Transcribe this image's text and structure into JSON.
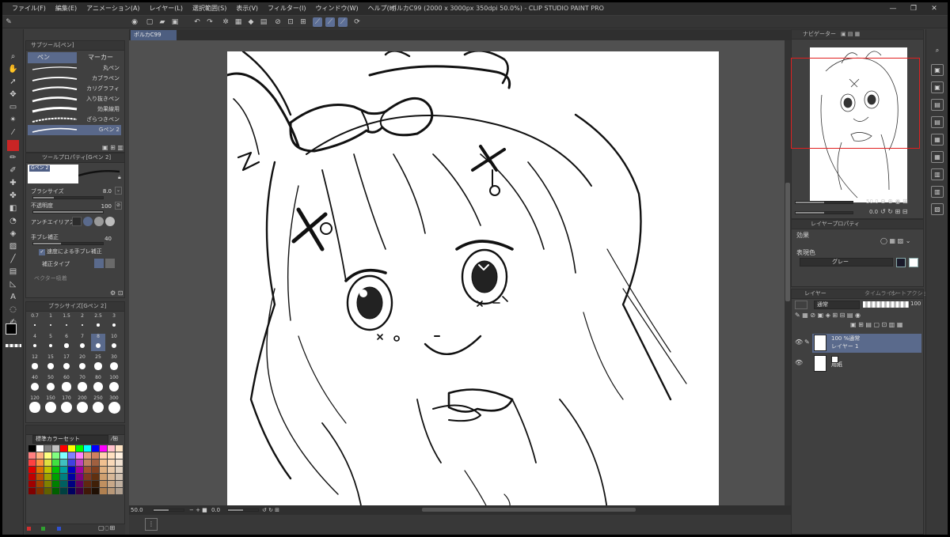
{
  "window": {
    "doc_title": "ポルカC99 (2000 x 3000px 350dpi 50.0%)  - CLIP STUDIO PAINT PRO",
    "controls": [
      "—",
      "❐",
      "✕"
    ]
  },
  "menu": [
    {
      "label": "ファイル(F)"
    },
    {
      "label": "編集(E)"
    },
    {
      "label": "アニメーション(A)"
    },
    {
      "label": "レイヤー(L)"
    },
    {
      "label": "選択範囲(S)"
    },
    {
      "label": "表示(V)"
    },
    {
      "label": "フィルター(I)"
    },
    {
      "label": "ウィンドウ(W)"
    },
    {
      "label": "ヘルプ(H)"
    }
  ],
  "subtool": {
    "tab_title": "サブツール[ペン]",
    "tabs": [
      {
        "label": "ペン"
      },
      {
        "label": "マーカー"
      }
    ],
    "brushes": [
      {
        "label": "丸ペン"
      },
      {
        "label": "カブラペン"
      },
      {
        "label": "カリグラフィ"
      },
      {
        "label": "入り抜きペン"
      },
      {
        "label": "効果線用"
      },
      {
        "label": "ざらつきペン"
      },
      {
        "label": "Gペン 2"
      }
    ]
  },
  "tool_property": {
    "tab_title": "ツールプロパティ[Gペン 2]",
    "brush_name": "Gペン 2",
    "brush_size_label": "ブラシサイズ",
    "brush_size_value": "8.0",
    "opacity_label": "不透明度",
    "opacity_value": "100",
    "antialias_label": "アンチエイリアス",
    "stabilization_label": "手ブレ補正",
    "stabilization_value": "40",
    "speed_stab_label": "速度による手ブレ補正",
    "correction_type_label": "補正タイプ",
    "vector_label": "ベクター吸着"
  },
  "brush_size_panel": {
    "tab_title": "ブラシサイズ[Gペン 2]",
    "sizes": [
      "0.7",
      "1",
      "1.5",
      "2",
      "2.5",
      "3",
      "4",
      "5",
      "6",
      "7",
      "8",
      "10",
      "12",
      "15",
      "17",
      "20",
      "25",
      "30",
      "40",
      "50",
      "60",
      "70",
      "80",
      "100",
      "120",
      "150",
      "170",
      "200",
      "250",
      "300"
    ]
  },
  "color_set": {
    "name": "標準カラーセット",
    "colors": [
      "#000000",
      "#ffffff",
      "#808080",
      "#c0c0c0",
      "#ff0000",
      "#ffff00",
      "#00ff00",
      "#00ffff",
      "#0000ff",
      "#ff00ff",
      "#ffc0cb",
      "#ffe4c4",
      "#ff8080",
      "#ffb080",
      "#ffff80",
      "#80ff80",
      "#80ffff",
      "#8080ff",
      "#ff80ff",
      "#e0a080",
      "#d08060",
      "#ffd0b0",
      "#ffe0c0",
      "#fff0e0",
      "#ff4040",
      "#ff9040",
      "#e0e040",
      "#40e040",
      "#40c0c0",
      "#4040e0",
      "#c040c0",
      "#c08060",
      "#a06040",
      "#f0c090",
      "#f8d8b8",
      "#f0e0d0",
      "#e00000",
      "#e07000",
      "#c0c000",
      "#00c000",
      "#00a0a0",
      "#0000c0",
      "#a000a0",
      "#a05030",
      "#804020",
      "#e0b080",
      "#e8c8a8",
      "#e0d0c0",
      "#c00000",
      "#c05000",
      "#a0a000",
      "#00a000",
      "#008080",
      "#0000a0",
      "#800080",
      "#803820",
      "#603010",
      "#d0a070",
      "#d8b898",
      "#d0c0b0",
      "#a00000",
      "#a04000",
      "#808000",
      "#008000",
      "#006060",
      "#000080",
      "#600060",
      "#602810",
      "#402008",
      "#c09060",
      "#c8a888",
      "#c0b0a0",
      "#800000",
      "#803000",
      "#606000",
      "#006000",
      "#004040",
      "#000060",
      "#400040",
      "#401808",
      "#201004",
      "#b08050",
      "#b89878",
      "#b0a090"
    ]
  },
  "document": {
    "tab": "ポルカC99",
    "zoom": "50.0",
    "angle": "0.0"
  },
  "navigator": {
    "tab_title": "ナビゲーター",
    "zoom": "50.0",
    "angle": "0.0"
  },
  "layer_property": {
    "tab_title": "レイヤープロパティ",
    "effect_label": "効果",
    "express_color_label": "表現色",
    "express_color_value": "グレー"
  },
  "layers": {
    "tab_title": "レイヤー",
    "other_tabs": [
      "オートアクション",
      "タイムライン"
    ],
    "blend_mode": "通常",
    "opacity": "100",
    "items": [
      {
        "line1": "100 %通常",
        "line2": "レイヤー 1"
      },
      {
        "line1": "",
        "line2": "用紙"
      }
    ]
  },
  "colors": {
    "accent": "#5a6a8c",
    "main_color": "#c92525"
  }
}
